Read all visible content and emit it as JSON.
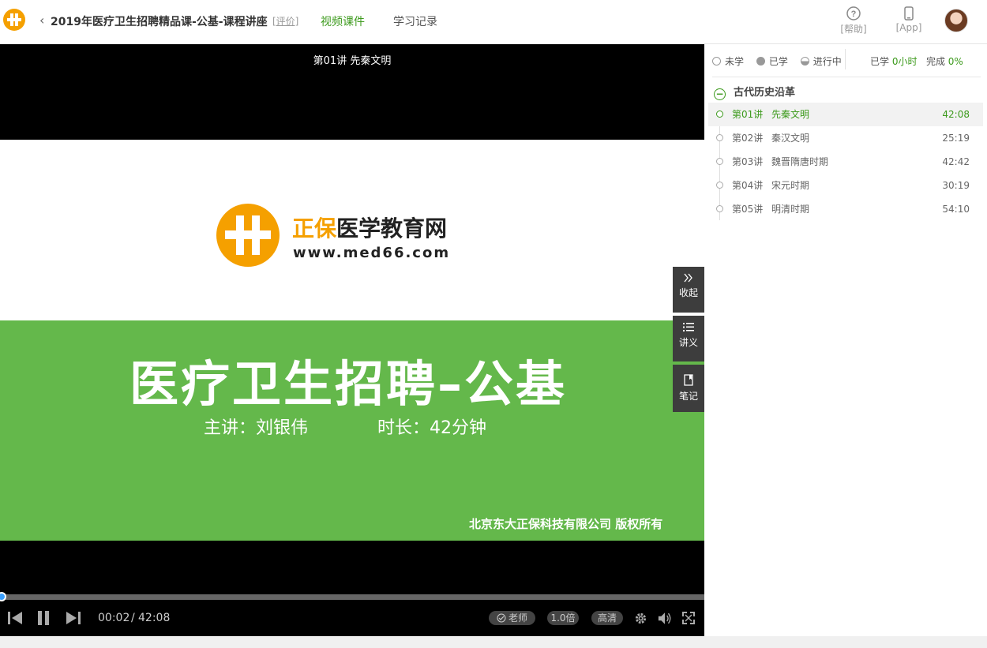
{
  "header": {
    "back_glyph": "‹",
    "title": "2019年医疗卫生招聘精品课-公基-课程讲座",
    "review": "[评价]",
    "nav": {
      "video": "视频课件",
      "record": "学习记录"
    },
    "help_label": "[帮助]",
    "app_label": "[App]"
  },
  "player": {
    "lecture_title": "第01讲  先秦文明",
    "brand_orange": "正保",
    "brand_dark": "医学教育网",
    "brand_url": "www.med66.com",
    "course": "医疗卫生招聘–公基",
    "teacher": "主讲：刘银伟",
    "duration": "时长：42分钟",
    "copyright": "北京东大正保科技有限公司  版权所有",
    "current_time": "00:02",
    "time_sep": "/",
    "total_time": "42:08",
    "progress": 0.001,
    "teacher_btn": "老师",
    "speed": "1.0倍",
    "quality": "高清"
  },
  "side_tools": {
    "collapse": "收起",
    "handout": "讲义",
    "notes": "笔记"
  },
  "panel": {
    "legend": {
      "unlearned": "未学",
      "learned": "已学",
      "in_progress": "进行中"
    },
    "stats": {
      "learned_label": "已学",
      "learned_value": "0小时",
      "done_label": "完成",
      "done_value": "0%"
    },
    "chapter_icon": "−",
    "chapter": "古代历史沿革",
    "lessons": [
      {
        "no": "第01讲",
        "name": "先秦文明",
        "dur": "42:08"
      },
      {
        "no": "第02讲",
        "name": "秦汉文明",
        "dur": "25:19"
      },
      {
        "no": "第03讲",
        "name": "魏晋隋唐时期",
        "dur": "42:42"
      },
      {
        "no": "第04讲",
        "name": "宋元时期",
        "dur": "30:19"
      },
      {
        "no": "第05讲",
        "name": "明清时期",
        "dur": "54:10"
      }
    ]
  },
  "colors": {
    "accent": "#3c9a1c",
    "brand_orange": "#f5a000",
    "slide_green": "#64b84b",
    "progress_blue": "#3aa0ff"
  },
  "icons": [
    "app-logo-icon",
    "back-chevron-icon",
    "help-icon",
    "phone-icon",
    "prev-icon",
    "pause-icon",
    "next-icon",
    "check-circle-icon",
    "gear-icon",
    "volume-icon",
    "fullscreen-icon",
    "double-chevron-icon",
    "list-icon",
    "note-icon"
  ]
}
